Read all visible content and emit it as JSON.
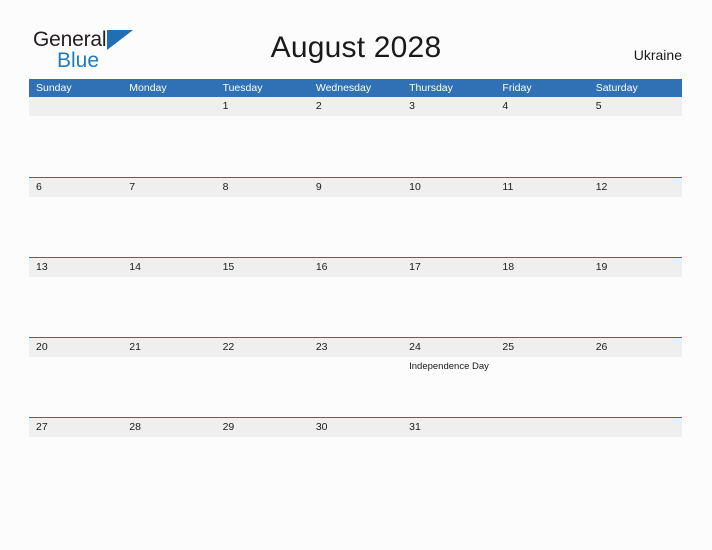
{
  "logo": {
    "text_top": "General",
    "text_bottom": "Blue",
    "flag_icon": "triangle-flag-icon",
    "color_primary": "#231f20",
    "color_accent": "#1f7bc4"
  },
  "header": {
    "title": "August 2028",
    "country": "Ukraine"
  },
  "calendar": {
    "accent_color": "#3070b4",
    "band_color": "#efefef",
    "weekday_headers": [
      "Sunday",
      "Monday",
      "Tuesday",
      "Wednesday",
      "Thursday",
      "Friday",
      "Saturday"
    ],
    "weeks": [
      [
        {
          "day": "",
          "events": []
        },
        {
          "day": "",
          "events": []
        },
        {
          "day": "1",
          "events": []
        },
        {
          "day": "2",
          "events": []
        },
        {
          "day": "3",
          "events": []
        },
        {
          "day": "4",
          "events": []
        },
        {
          "day": "5",
          "events": []
        }
      ],
      [
        {
          "day": "6",
          "events": []
        },
        {
          "day": "7",
          "events": []
        },
        {
          "day": "8",
          "events": []
        },
        {
          "day": "9",
          "events": []
        },
        {
          "day": "10",
          "events": []
        },
        {
          "day": "11",
          "events": []
        },
        {
          "day": "12",
          "events": []
        }
      ],
      [
        {
          "day": "13",
          "events": []
        },
        {
          "day": "14",
          "events": []
        },
        {
          "day": "15",
          "events": []
        },
        {
          "day": "16",
          "events": []
        },
        {
          "day": "17",
          "events": []
        },
        {
          "day": "18",
          "events": []
        },
        {
          "day": "19",
          "events": []
        }
      ],
      [
        {
          "day": "20",
          "events": []
        },
        {
          "day": "21",
          "events": []
        },
        {
          "day": "22",
          "events": []
        },
        {
          "day": "23",
          "events": []
        },
        {
          "day": "24",
          "events": [
            "Independence Day"
          ]
        },
        {
          "day": "25",
          "events": []
        },
        {
          "day": "26",
          "events": []
        }
      ],
      [
        {
          "day": "27",
          "events": []
        },
        {
          "day": "28",
          "events": []
        },
        {
          "day": "29",
          "events": []
        },
        {
          "day": "30",
          "events": []
        },
        {
          "day": "31",
          "events": []
        },
        {
          "day": "",
          "events": []
        },
        {
          "day": "",
          "events": []
        }
      ]
    ]
  }
}
